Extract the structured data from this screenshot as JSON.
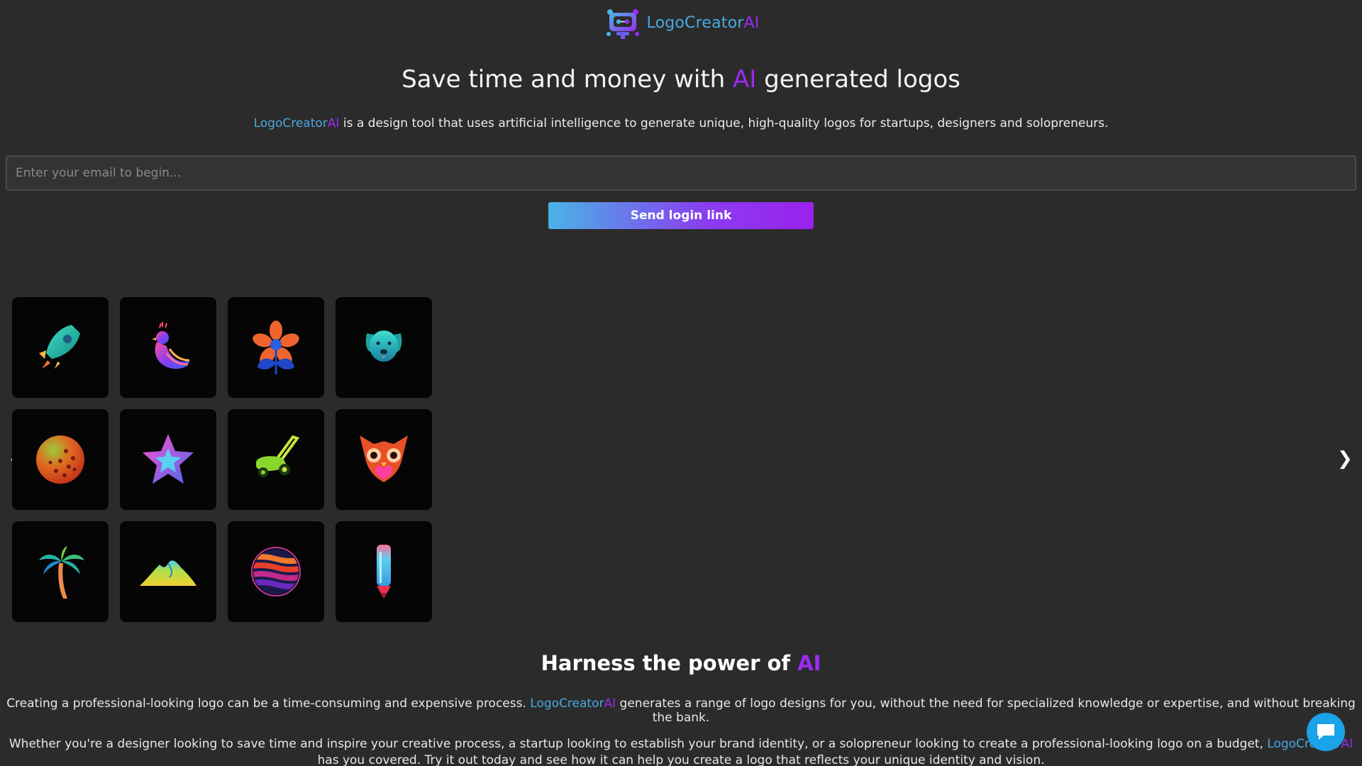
{
  "header": {
    "brand_part1": "LogoCreator",
    "brand_part2": "AI",
    "logo_icon": "robot-logo-icon"
  },
  "hero": {
    "title_before": "Save time and money with ",
    "title_highlight": "AI",
    "title_after": " generated logos",
    "subtitle_brand1": "LogoCreator",
    "subtitle_brand2": "AI",
    "subtitle_text": " is a design tool that uses artificial intelligence to generate unique, high-quality logos for startups, designers and solopreneurs."
  },
  "login": {
    "email_placeholder": "Enter your email to begin...",
    "email_value": "",
    "send_label": "Send login link"
  },
  "carousel": {
    "prev_label": "❮",
    "next_label": "❯",
    "tiles": [
      {
        "icon": "rocket-icon"
      },
      {
        "icon": "peacock-icon"
      },
      {
        "icon": "flower-icon"
      },
      {
        "icon": "dog-icon"
      },
      {
        "icon": "ball-icon"
      },
      {
        "icon": "star-icon"
      },
      {
        "icon": "lawnmower-icon"
      },
      {
        "icon": "owl-icon"
      },
      {
        "icon": "palm-tree-icon"
      },
      {
        "icon": "mountain-icon"
      },
      {
        "icon": "sunset-circle-icon"
      },
      {
        "icon": "pencil-icon"
      }
    ]
  },
  "section": {
    "title_before": "Harness the power of ",
    "title_highlight": "AI",
    "p1_before": "Creating a professional-looking logo can be a time-consuming and expensive process. ",
    "p1_brand1": "LogoCreator",
    "p1_brand2": "AI",
    "p1_after": " generates a range of logo designs for you, without the need for specialized knowledge or expertise, and without breaking the bank.",
    "p2_before": "Whether you're a designer looking to save time and inspire your creative process, a startup looking to establish your brand identity, or a solopreneur looking to create a professional-looking logo on a budget, ",
    "p2_brand1": "LogoCreator",
    "p2_brand2": "AI",
    "p2_after": " has you covered. Try it out today and see how it can help you create a logo that reflects your unique identity and vision."
  },
  "chat": {
    "icon": "chat-bubble-icon"
  },
  "colors": {
    "background": "#2b2b2c",
    "brand_blue": "#4aa8e0",
    "brand_purple": "#9a2cf0",
    "chat_blue": "#1aa3e8"
  }
}
